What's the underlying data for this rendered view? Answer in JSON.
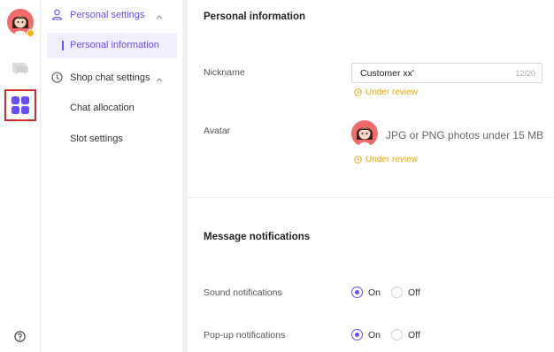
{
  "rail": {
    "icons": [
      "avatar",
      "chat-icon",
      "apps-grid-icon",
      "help-icon"
    ],
    "status_color": "#f5b400",
    "selected_outline_color": "#d8282f"
  },
  "nav": {
    "groups": [
      {
        "label": "Personal settings",
        "icon": "person-icon",
        "expanded": true
      },
      {
        "label": "Shop chat settings",
        "icon": "clock-icon",
        "expanded": true
      }
    ],
    "items": [
      {
        "label": "Personal information",
        "active": true
      },
      {
        "label": "Chat allocation",
        "active": false
      },
      {
        "label": "Slot settings",
        "active": false
      }
    ],
    "accent_color": "#6a4cff"
  },
  "main": {
    "personal": {
      "title": "Personal information",
      "nickname_label": "Nickname",
      "nickname_value": "Customer xx'",
      "nickname_count": "12/20",
      "nickname_status": "Under review",
      "avatar_label": "Avatar",
      "avatar_hint": "JPG or PNG photos under 15 MB",
      "avatar_status": "Under review",
      "status_color": "#f0a500"
    },
    "notifications": {
      "title": "Message notifications",
      "rows": [
        {
          "label": "Sound notifications",
          "on_label": "On",
          "off_label": "Off",
          "selected": "On"
        },
        {
          "label": "Pop-up notifications",
          "on_label": "On",
          "off_label": "Off",
          "selected": "On"
        }
      ]
    }
  }
}
